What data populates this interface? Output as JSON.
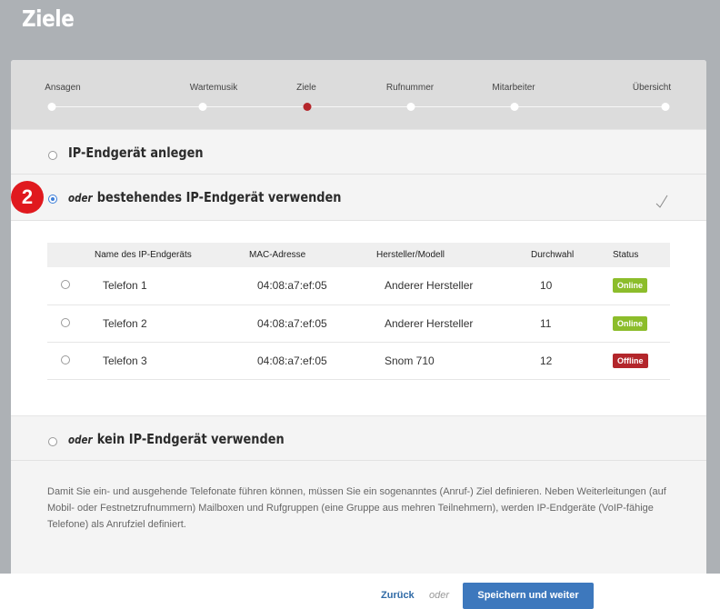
{
  "page": {
    "title": "Ziele"
  },
  "stepper": {
    "steps": [
      {
        "label": "Ansagen",
        "active": false
      },
      {
        "label": "Wartemusik",
        "active": false
      },
      {
        "label": "Ziele",
        "active": true
      },
      {
        "label": "Rufnummer",
        "active": false
      },
      {
        "label": "Mitarbeiter",
        "active": false
      },
      {
        "label": "Übersicht",
        "active": false
      }
    ]
  },
  "options": {
    "create": {
      "label": "IP-Endgerät anlegen",
      "selected": false
    },
    "existing": {
      "prefix": "oder",
      "label": "bestehendes IP-Endgerät verwenden",
      "selected": true
    },
    "none": {
      "prefix": "oder",
      "label": "kein IP-Endgerät verwenden",
      "selected": false
    }
  },
  "table": {
    "columns": [
      "Name des IP-Endgeräts",
      "MAC-Adresse",
      "Hersteller/Modell",
      "Durchwahl",
      "Status"
    ],
    "rows": [
      {
        "name": "Telefon 1",
        "mac": "04:08:a7:ef:05",
        "vendor": "Anderer Hersteller",
        "ext": "10",
        "status": "Online"
      },
      {
        "name": "Telefon 2",
        "mac": "04:08:a7:ef:05",
        "vendor": "Anderer Hersteller",
        "ext": "11",
        "status": "Online"
      },
      {
        "name": "Telefon 3",
        "mac": "04:08:a7:ef:05",
        "vendor": "Snom 710",
        "ext": "12",
        "status": "Offline"
      }
    ]
  },
  "status_colors": {
    "Online": "#8cbd2b",
    "Offline": "#b3262b"
  },
  "note": "Damit Sie ein- und ausgehende Telefonate führen können, müssen Sie ein sogenanntes (Anruf-) Ziel definieren. Neben Weiterleitungen (auf Mobil- oder Festnetzrufnummern) Mailboxen und Rufgruppen (eine Gruppe aus mehren Teilnehmern), werden IP-Endgeräte (VoIP-fähige Telefone) als Anrufziel definiert.",
  "footer": {
    "back_label": "Zurück",
    "or_label": "oder",
    "save_label": "Speichern und weiter"
  },
  "callout": {
    "number": "2"
  }
}
